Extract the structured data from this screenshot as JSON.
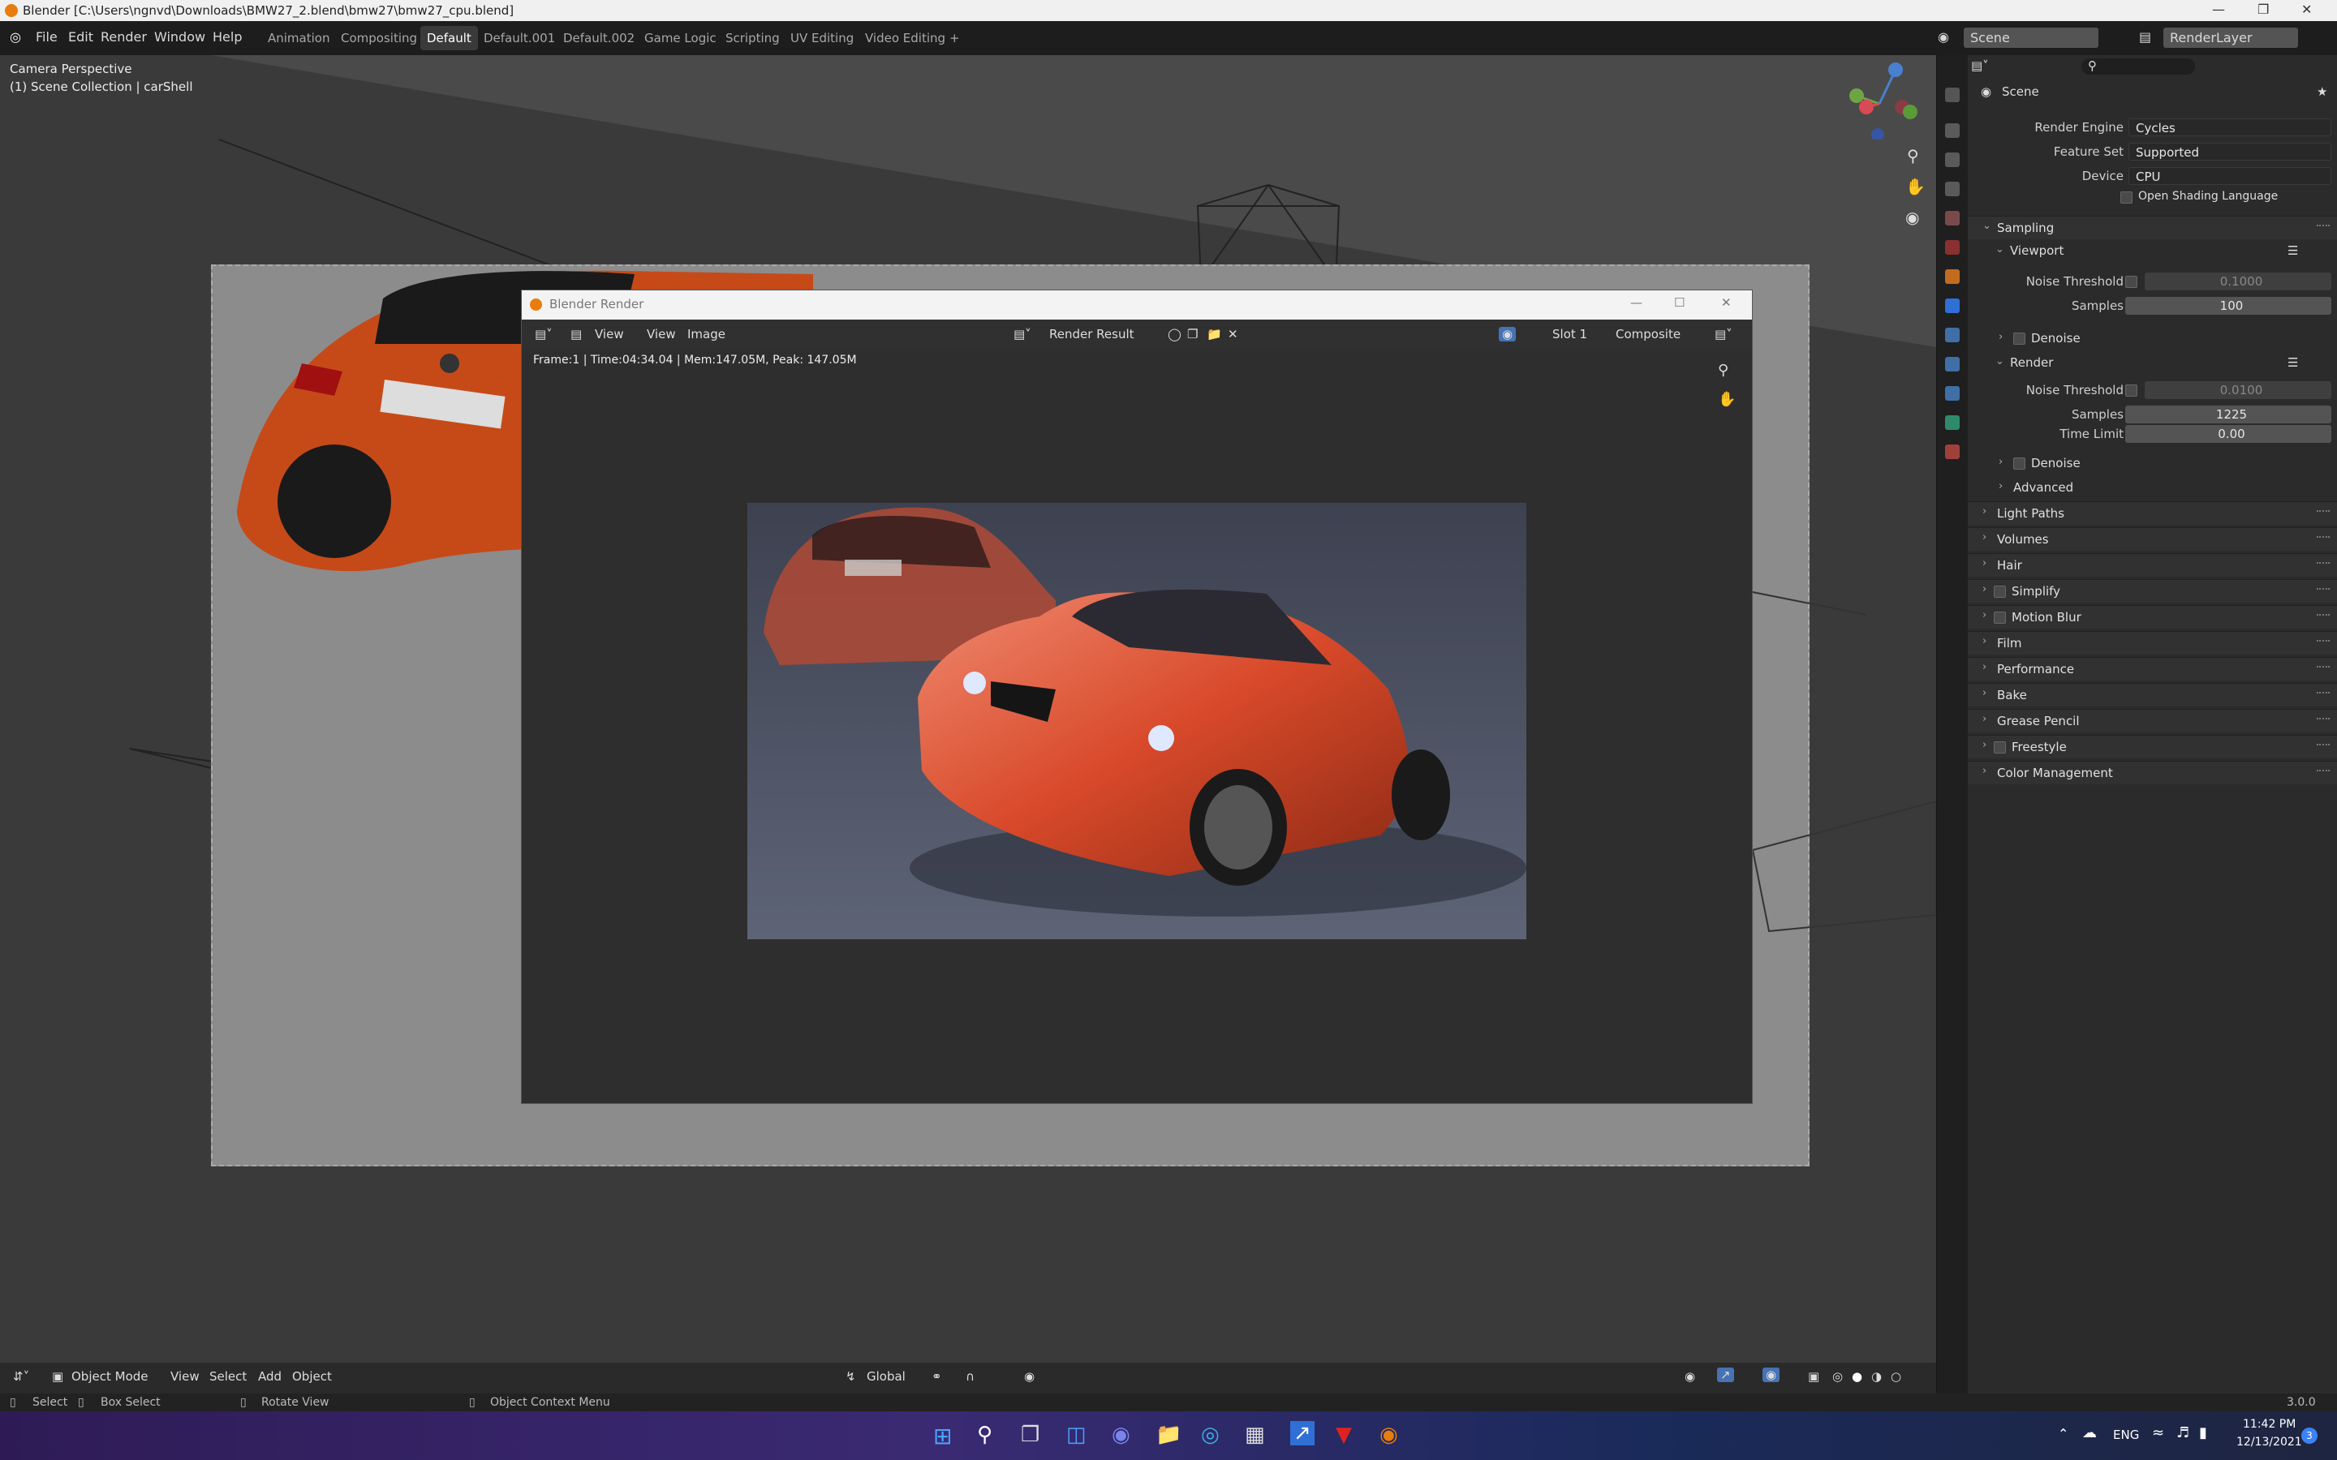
{
  "window": {
    "title": "Blender [C:\\Users\\ngnvd\\Downloads\\BMW27_2.blend\\bmw27\\bmw27_cpu.blend]"
  },
  "menu": {
    "items": [
      "File",
      "Edit",
      "Render",
      "Window",
      "Help"
    ]
  },
  "workspaces": {
    "tabs": [
      "Animation",
      "Compositing",
      "Default",
      "Default.001",
      "Default.002",
      "Game Logic",
      "Scripting",
      "UV Editing",
      "Video Editing"
    ],
    "active": "Default",
    "add": "+"
  },
  "header_right": {
    "scene": "Scene",
    "view_layer": "RenderLayer"
  },
  "viewport": {
    "overlay_title": "Camera Perspective",
    "overlay_subtitle": "(1) Scene Collection | carShell"
  },
  "render_window": {
    "title": "Blender Render",
    "menu": [
      "View",
      "View",
      "Image"
    ],
    "image_name": "Render Result",
    "slot": "Slot 1",
    "pass": "Composite",
    "stats": "Frame:1 | Time:04:34.04 | Mem:147.05M, Peak: 147.05M"
  },
  "viewport_toolbar": {
    "mode": "Object Mode",
    "menus": [
      "View",
      "Select",
      "Add",
      "Object"
    ],
    "orientation": "Global"
  },
  "statusbar": {
    "select": "Select",
    "box_select": "Box Select",
    "rotate": "Rotate View",
    "context": "Object Context Menu",
    "version": "3.0.0"
  },
  "taskbar": {
    "lang": "ENG",
    "time": "11:42 PM",
    "date": "12/13/2021",
    "badge": "3"
  },
  "properties": {
    "title": "Scene",
    "render_engine_label": "Render Engine",
    "render_engine": "Cycles",
    "feature_set_label": "Feature Set",
    "feature_set": "Supported",
    "device_label": "Device",
    "device": "CPU",
    "osl_label": "Open Shading Language",
    "sampling": "Sampling",
    "viewport": "Viewport",
    "vp_noise_label": "Noise Threshold",
    "vp_noise": "0.1000",
    "vp_samples_label": "Samples",
    "vp_samples": "100",
    "denoise": "Denoise",
    "render": "Render",
    "r_noise_label": "Noise Threshold",
    "r_noise": "0.0100",
    "r_samples_label": "Samples",
    "r_samples": "1225",
    "time_limit_label": "Time Limit",
    "time_limit": "0.00",
    "denoise2": "Denoise",
    "advanced": "Advanced",
    "sections": [
      "Light Paths",
      "Volumes",
      "Hair",
      "Simplify",
      "Motion Blur",
      "Film",
      "Performance",
      "Bake",
      "Grease Pencil",
      "Freestyle",
      "Color Management"
    ]
  }
}
